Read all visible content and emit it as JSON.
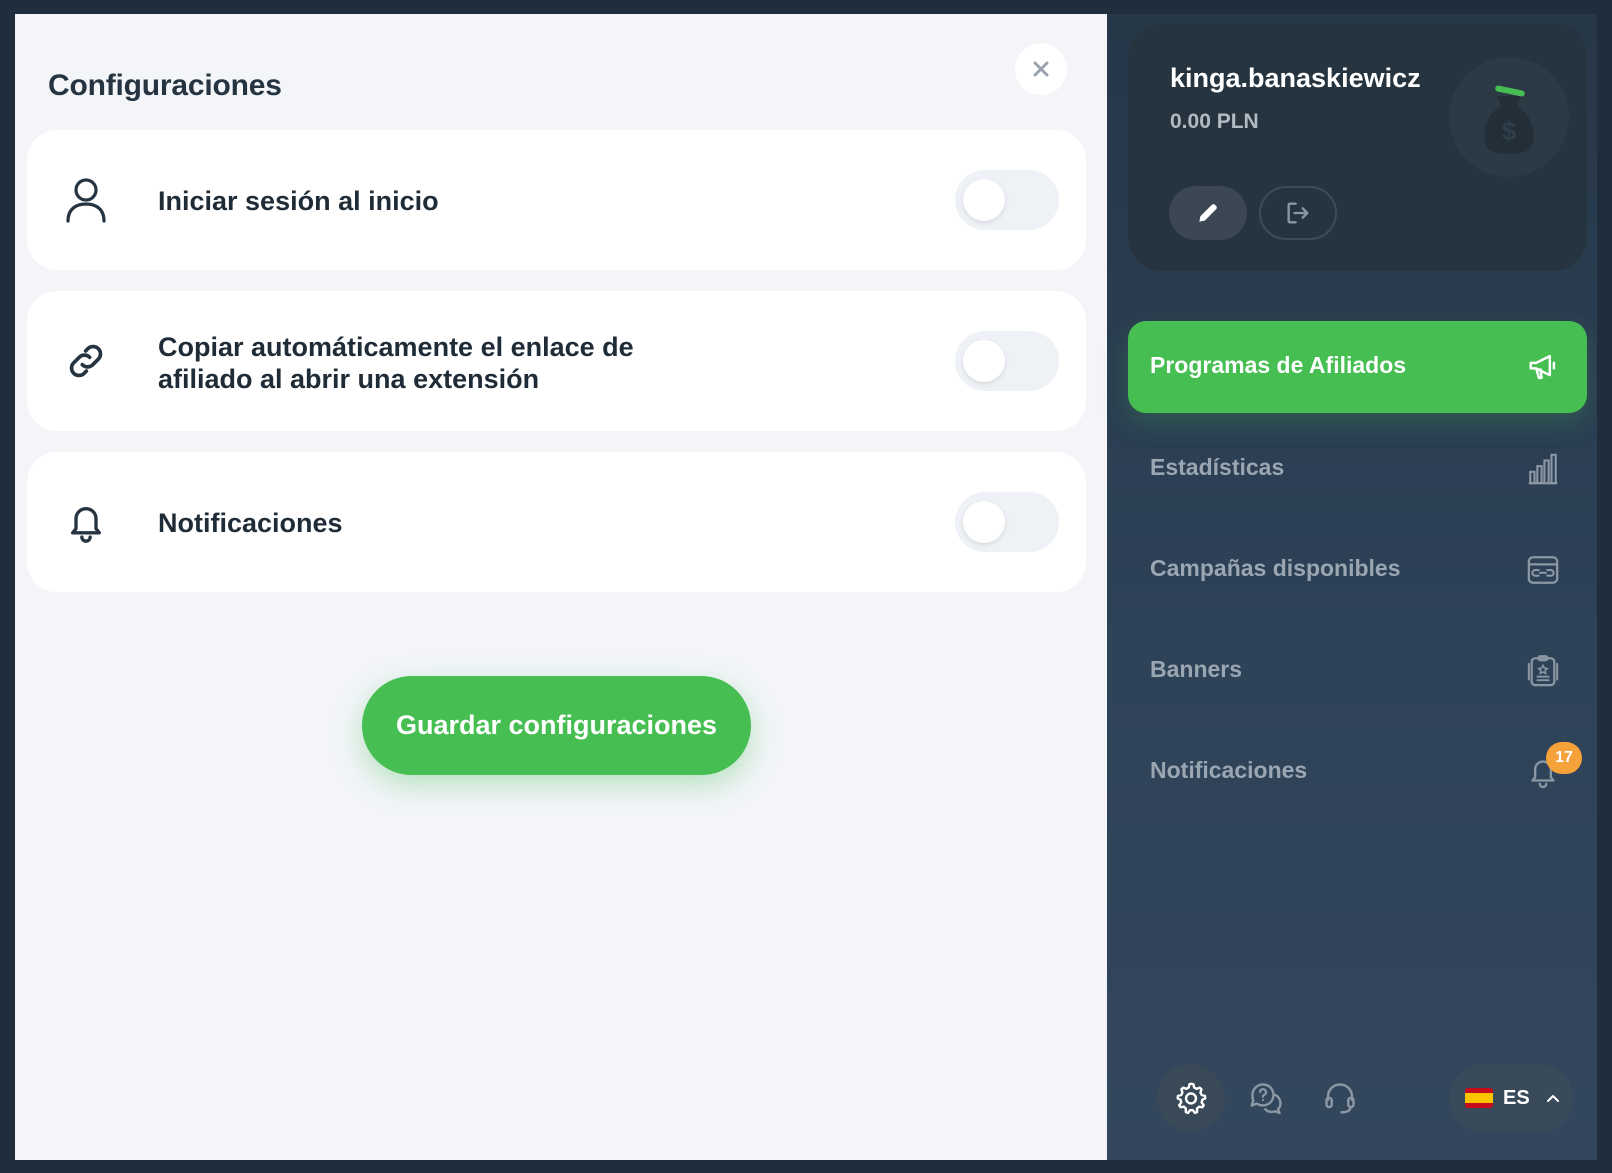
{
  "settings": {
    "title": "Configuraciones",
    "items": [
      {
        "label": "Iniciar sesión al inicio",
        "icon": "user-icon",
        "enabled": false
      },
      {
        "label_line1": "Copiar automáticamente el enlace de",
        "label_line2": "afiliado al abrir una extensión",
        "icon": "link-icon",
        "enabled": false
      },
      {
        "label": "Notificaciones",
        "icon": "bell-icon",
        "enabled": false
      }
    ],
    "save_label": "Guardar configuraciones"
  },
  "account": {
    "username": "kinga.banaskiewicz",
    "balance": "0.00 PLN"
  },
  "nav": {
    "items": [
      {
        "label": "Programas de Afiliados",
        "icon": "megaphone-icon",
        "active": true
      },
      {
        "label": "Estadísticas",
        "icon": "bar-chart-icon"
      },
      {
        "label": "Campañas disponibles",
        "icon": "campaign-link-icon"
      },
      {
        "label": "Banners",
        "icon": "banner-clipboard-icon"
      },
      {
        "label": "Notificaciones",
        "icon": "bell-icon",
        "badge": "17"
      }
    ]
  },
  "bottom": {
    "language": "ES"
  },
  "colors": {
    "accent": "#46be52",
    "badge": "#f5a23a",
    "text_dark": "#1f2c38",
    "sidebar_text": "#9aa6b2"
  }
}
